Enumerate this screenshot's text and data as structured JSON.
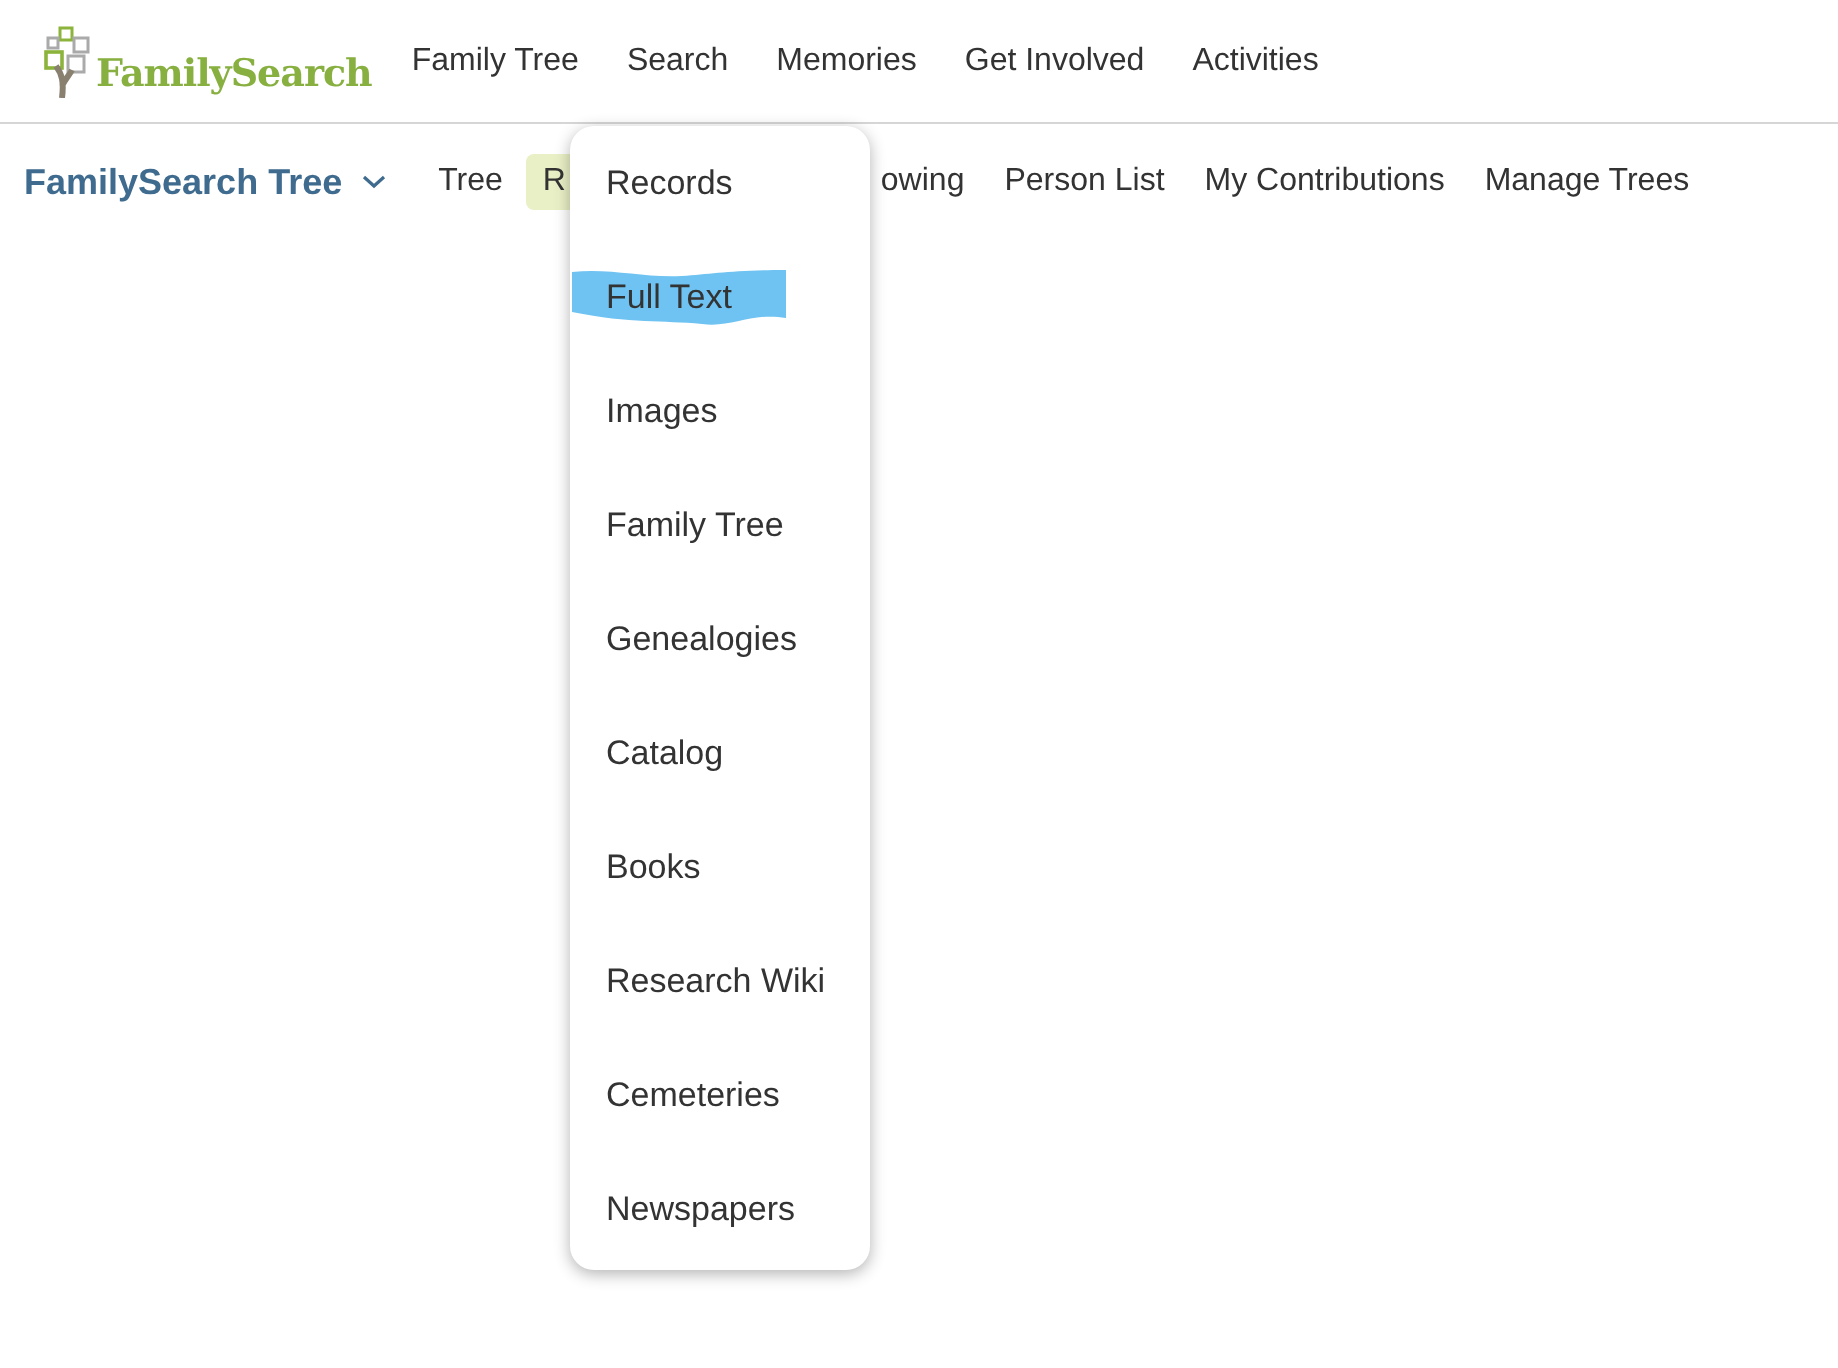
{
  "header": {
    "logo_text": "FamilySearch",
    "nav": [
      {
        "label": "Family Tree"
      },
      {
        "label": "Search"
      },
      {
        "label": "Memories"
      },
      {
        "label": "Get Involved"
      },
      {
        "label": "Activities"
      }
    ]
  },
  "subnav": {
    "title": "FamilySearch Tree",
    "tabs": [
      {
        "label": "Tree",
        "selected": false
      },
      {
        "label": "R",
        "selected": true
      },
      {
        "label": "owing",
        "selected": false
      },
      {
        "label": "Person List",
        "selected": false
      },
      {
        "label": "My Contributions",
        "selected": false
      },
      {
        "label": "Manage Trees",
        "selected": false
      }
    ]
  },
  "search_menu": {
    "items": [
      {
        "label": "Records",
        "highlighted": false
      },
      {
        "label": "Full Text",
        "highlighted": true
      },
      {
        "label": "Images",
        "highlighted": false
      },
      {
        "label": "Family Tree",
        "highlighted": false
      },
      {
        "label": "Genealogies",
        "highlighted": false
      },
      {
        "label": "Catalog",
        "highlighted": false
      },
      {
        "label": "Books",
        "highlighted": false
      },
      {
        "label": "Research Wiki",
        "highlighted": false
      },
      {
        "label": "Cemeteries",
        "highlighted": false
      },
      {
        "label": "Newspapers",
        "highlighted": false
      }
    ]
  }
}
